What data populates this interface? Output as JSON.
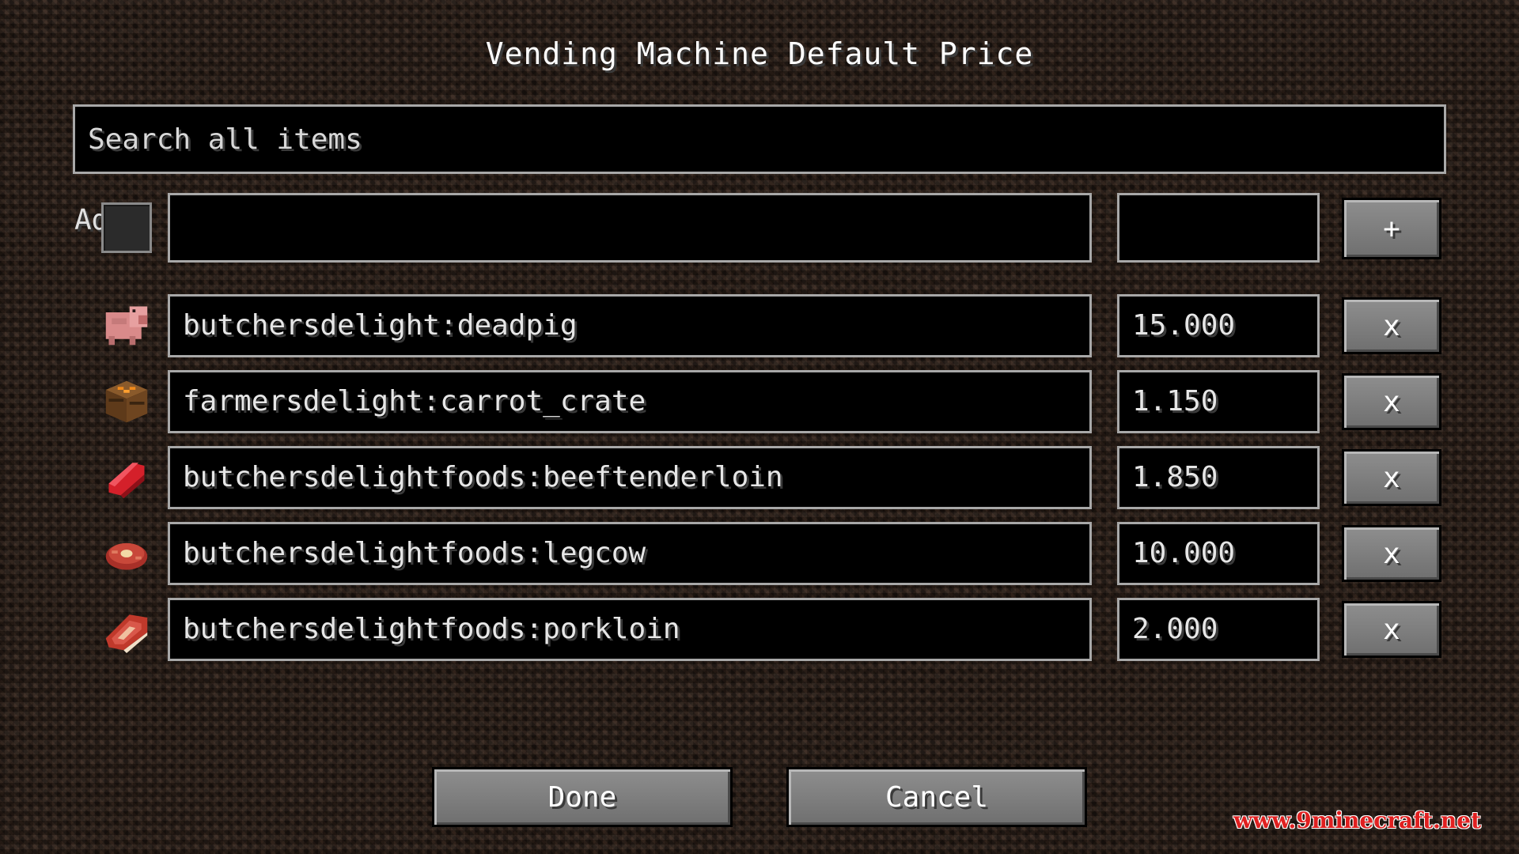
{
  "title": "Vending Machine Default Price",
  "search": {
    "placeholder": "Search all items"
  },
  "add_row": {
    "label": "Ad",
    "item_value": "",
    "price_value": "",
    "add_button": "+"
  },
  "items": [
    {
      "id": "butchersdelight:deadpig",
      "price": "15.000",
      "icon": "dead-pig-icon",
      "remove_label": "x"
    },
    {
      "id": "farmersdelight:carrot_crate",
      "price": "1.150",
      "icon": "carrot-crate-icon",
      "remove_label": "x"
    },
    {
      "id": "butchersdelightfoods:beeftenderloin",
      "price": "1.850",
      "icon": "beef-tenderloin-icon",
      "remove_label": "x"
    },
    {
      "id": "butchersdelightfoods:legcow",
      "price": "10.000",
      "icon": "leg-cow-icon",
      "remove_label": "x"
    },
    {
      "id": "butchersdelightfoods:porkloin",
      "price": "2.000",
      "icon": "pork-loin-icon",
      "remove_label": "x"
    }
  ],
  "footer": {
    "done_label": "Done",
    "cancel_label": "Cancel"
  },
  "watermark": "www.9minecraft.net",
  "colors": {
    "background": "#2a1e17",
    "field_border": "#a8a8a8",
    "button": "#7f7f7f",
    "watermark": "#e02020"
  }
}
